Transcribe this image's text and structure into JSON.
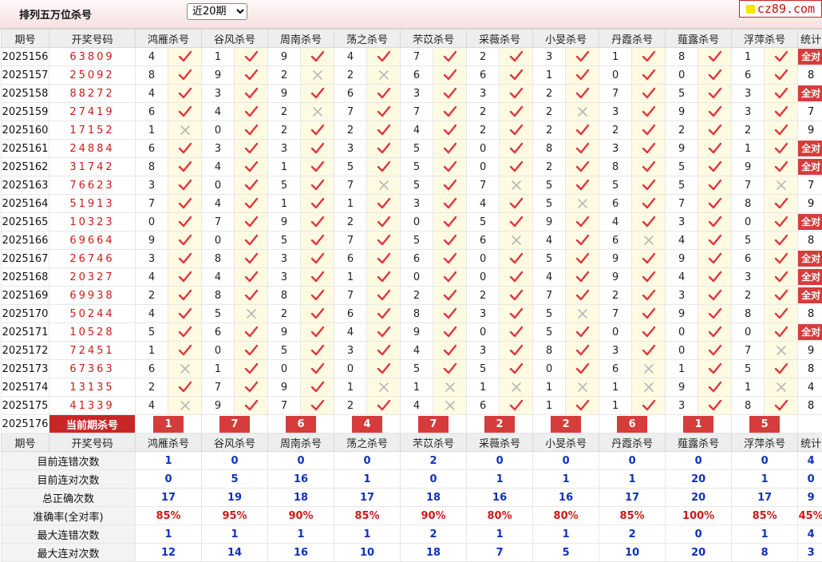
{
  "header": {
    "title": "排列五万位杀号",
    "period_select": "近20期",
    "logo_text": "cz89.com"
  },
  "columns": [
    "期号",
    "开奖号码",
    "鸿雁杀号",
    "谷风杀号",
    "周南杀号",
    "荡之杀号",
    "芣苡杀号",
    "采薇杀号",
    "小旻杀号",
    "丹霞杀号",
    "薤露杀号",
    "浮萍杀号",
    "统计"
  ],
  "all_right_label": "全对",
  "rows": [
    {
      "issue": "2025156",
      "nums": "63809",
      "kills": [
        [
          4,
          1
        ],
        [
          1,
          1
        ],
        [
          9,
          1
        ],
        [
          4,
          1
        ],
        [
          7,
          1
        ],
        [
          2,
          1
        ],
        [
          3,
          1
        ],
        [
          1,
          1
        ],
        [
          8,
          1
        ],
        [
          1,
          1
        ]
      ],
      "stat": "全对"
    },
    {
      "issue": "2025157",
      "nums": "25092",
      "kills": [
        [
          8,
          1
        ],
        [
          9,
          1
        ],
        [
          2,
          0
        ],
        [
          2,
          0
        ],
        [
          6,
          1
        ],
        [
          6,
          1
        ],
        [
          1,
          1
        ],
        [
          0,
          1
        ],
        [
          0,
          1
        ],
        [
          6,
          1
        ]
      ],
      "stat": "8"
    },
    {
      "issue": "2025158",
      "nums": "88272",
      "kills": [
        [
          4,
          1
        ],
        [
          3,
          1
        ],
        [
          9,
          1
        ],
        [
          6,
          1
        ],
        [
          3,
          1
        ],
        [
          3,
          1
        ],
        [
          2,
          1
        ],
        [
          7,
          1
        ],
        [
          5,
          1
        ],
        [
          3,
          1
        ]
      ],
      "stat": "全对"
    },
    {
      "issue": "2025159",
      "nums": "27419",
      "kills": [
        [
          6,
          1
        ],
        [
          4,
          1
        ],
        [
          2,
          0
        ],
        [
          7,
          1
        ],
        [
          7,
          1
        ],
        [
          2,
          1
        ],
        [
          2,
          0
        ],
        [
          3,
          1
        ],
        [
          9,
          1
        ],
        [
          3,
          1
        ]
      ],
      "stat": "7"
    },
    {
      "issue": "2025160",
      "nums": "17152",
      "kills": [
        [
          1,
          0
        ],
        [
          0,
          1
        ],
        [
          2,
          1
        ],
        [
          2,
          1
        ],
        [
          4,
          1
        ],
        [
          2,
          1
        ],
        [
          2,
          1
        ],
        [
          2,
          1
        ],
        [
          2,
          1
        ],
        [
          2,
          1
        ]
      ],
      "stat": "9"
    },
    {
      "issue": "2025161",
      "nums": "24884",
      "kills": [
        [
          6,
          1
        ],
        [
          3,
          1
        ],
        [
          3,
          1
        ],
        [
          3,
          1
        ],
        [
          5,
          1
        ],
        [
          0,
          1
        ],
        [
          8,
          1
        ],
        [
          3,
          1
        ],
        [
          9,
          1
        ],
        [
          1,
          1
        ]
      ],
      "stat": "全对"
    },
    {
      "issue": "2025162",
      "nums": "31742",
      "kills": [
        [
          8,
          1
        ],
        [
          4,
          1
        ],
        [
          1,
          1
        ],
        [
          5,
          1
        ],
        [
          5,
          1
        ],
        [
          0,
          1
        ],
        [
          2,
          1
        ],
        [
          8,
          1
        ],
        [
          5,
          1
        ],
        [
          9,
          1
        ]
      ],
      "stat": "全对"
    },
    {
      "issue": "2025163",
      "nums": "76623",
      "kills": [
        [
          3,
          1
        ],
        [
          0,
          1
        ],
        [
          5,
          1
        ],
        [
          7,
          0
        ],
        [
          5,
          1
        ],
        [
          7,
          0
        ],
        [
          5,
          1
        ],
        [
          5,
          1
        ],
        [
          5,
          1
        ],
        [
          7,
          0
        ]
      ],
      "stat": "7"
    },
    {
      "issue": "2025164",
      "nums": "51913",
      "kills": [
        [
          7,
          1
        ],
        [
          4,
          1
        ],
        [
          1,
          1
        ],
        [
          1,
          1
        ],
        [
          3,
          1
        ],
        [
          4,
          1
        ],
        [
          5,
          0
        ],
        [
          6,
          1
        ],
        [
          7,
          1
        ],
        [
          8,
          1
        ]
      ],
      "stat": "9"
    },
    {
      "issue": "2025165",
      "nums": "10323",
      "kills": [
        [
          0,
          1
        ],
        [
          7,
          1
        ],
        [
          9,
          1
        ],
        [
          2,
          1
        ],
        [
          0,
          1
        ],
        [
          5,
          1
        ],
        [
          9,
          1
        ],
        [
          4,
          1
        ],
        [
          3,
          1
        ],
        [
          0,
          1
        ]
      ],
      "stat": "全对"
    },
    {
      "issue": "2025166",
      "nums": "69664",
      "kills": [
        [
          9,
          1
        ],
        [
          0,
          1
        ],
        [
          5,
          1
        ],
        [
          7,
          1
        ],
        [
          5,
          1
        ],
        [
          6,
          0
        ],
        [
          4,
          1
        ],
        [
          6,
          0
        ],
        [
          4,
          1
        ],
        [
          5,
          1
        ]
      ],
      "stat": "8"
    },
    {
      "issue": "2025167",
      "nums": "26746",
      "kills": [
        [
          3,
          1
        ],
        [
          8,
          1
        ],
        [
          3,
          1
        ],
        [
          6,
          1
        ],
        [
          6,
          1
        ],
        [
          0,
          1
        ],
        [
          5,
          1
        ],
        [
          9,
          1
        ],
        [
          9,
          1
        ],
        [
          6,
          1
        ]
      ],
      "stat": "全对"
    },
    {
      "issue": "2025168",
      "nums": "20327",
      "kills": [
        [
          4,
          1
        ],
        [
          4,
          1
        ],
        [
          3,
          1
        ],
        [
          1,
          1
        ],
        [
          0,
          1
        ],
        [
          0,
          1
        ],
        [
          4,
          1
        ],
        [
          9,
          1
        ],
        [
          4,
          1
        ],
        [
          3,
          1
        ]
      ],
      "stat": "全对"
    },
    {
      "issue": "2025169",
      "nums": "69938",
      "kills": [
        [
          2,
          1
        ],
        [
          8,
          1
        ],
        [
          8,
          1
        ],
        [
          7,
          1
        ],
        [
          2,
          1
        ],
        [
          2,
          1
        ],
        [
          7,
          1
        ],
        [
          2,
          1
        ],
        [
          3,
          1
        ],
        [
          2,
          1
        ]
      ],
      "stat": "全对"
    },
    {
      "issue": "2025170",
      "nums": "50244",
      "kills": [
        [
          4,
          1
        ],
        [
          5,
          0
        ],
        [
          2,
          1
        ],
        [
          6,
          1
        ],
        [
          8,
          1
        ],
        [
          3,
          1
        ],
        [
          5,
          0
        ],
        [
          7,
          1
        ],
        [
          9,
          1
        ],
        [
          8,
          1
        ]
      ],
      "stat": "8"
    },
    {
      "issue": "2025171",
      "nums": "10528",
      "kills": [
        [
          5,
          1
        ],
        [
          6,
          1
        ],
        [
          9,
          1
        ],
        [
          4,
          1
        ],
        [
          9,
          1
        ],
        [
          0,
          1
        ],
        [
          5,
          1
        ],
        [
          0,
          1
        ],
        [
          0,
          1
        ],
        [
          0,
          1
        ]
      ],
      "stat": "全对"
    },
    {
      "issue": "2025172",
      "nums": "72451",
      "kills": [
        [
          1,
          1
        ],
        [
          0,
          1
        ],
        [
          5,
          1
        ],
        [
          3,
          1
        ],
        [
          4,
          1
        ],
        [
          3,
          1
        ],
        [
          8,
          1
        ],
        [
          3,
          1
        ],
        [
          0,
          1
        ],
        [
          7,
          0
        ]
      ],
      "stat": "9"
    },
    {
      "issue": "2025173",
      "nums": "67363",
      "kills": [
        [
          6,
          0
        ],
        [
          1,
          1
        ],
        [
          0,
          1
        ],
        [
          0,
          1
        ],
        [
          5,
          1
        ],
        [
          5,
          1
        ],
        [
          0,
          1
        ],
        [
          6,
          0
        ],
        [
          1,
          1
        ],
        [
          5,
          1
        ]
      ],
      "stat": "8"
    },
    {
      "issue": "2025174",
      "nums": "13135",
      "kills": [
        [
          2,
          1
        ],
        [
          7,
          1
        ],
        [
          9,
          1
        ],
        [
          1,
          0
        ],
        [
          1,
          0
        ],
        [
          1,
          0
        ],
        [
          1,
          0
        ],
        [
          1,
          0
        ],
        [
          9,
          1
        ],
        [
          1,
          0
        ]
      ],
      "stat": "4"
    },
    {
      "issue": "2025175",
      "nums": "41339",
      "kills": [
        [
          4,
          0
        ],
        [
          9,
          1
        ],
        [
          7,
          1
        ],
        [
          2,
          1
        ],
        [
          4,
          0
        ],
        [
          6,
          1
        ],
        [
          1,
          1
        ],
        [
          1,
          1
        ],
        [
          3,
          1
        ],
        [
          8,
          1
        ]
      ],
      "stat": "8"
    }
  ],
  "current": {
    "issue": "2025176",
    "label": "当前期杀号",
    "kills": [
      "1",
      "7",
      "6",
      "4",
      "7",
      "2",
      "2",
      "6",
      "1",
      "5"
    ]
  },
  "summary": [
    {
      "label": "目前连错次数",
      "values": [
        "1",
        "0",
        "0",
        "0",
        "2",
        "0",
        "0",
        "0",
        "0",
        "0"
      ],
      "stat": "4"
    },
    {
      "label": "目前连对次数",
      "values": [
        "0",
        "5",
        "16",
        "1",
        "0",
        "1",
        "1",
        "1",
        "20",
        "1"
      ],
      "stat": "0"
    },
    {
      "label": "总正确次数",
      "values": [
        "17",
        "19",
        "18",
        "17",
        "18",
        "16",
        "16",
        "17",
        "20",
        "17"
      ],
      "stat": "9"
    },
    {
      "label": "准确率(全对率)",
      "values": [
        "85%",
        "95%",
        "90%",
        "85%",
        "90%",
        "80%",
        "80%",
        "85%",
        "100%",
        "85%"
      ],
      "stat": "45%"
    },
    {
      "label": "最大连错次数",
      "values": [
        "1",
        "1",
        "1",
        "1",
        "2",
        "1",
        "1",
        "2",
        "0",
        "1"
      ],
      "stat": "4"
    },
    {
      "label": "最大连对次数",
      "values": [
        "12",
        "14",
        "16",
        "10",
        "18",
        "7",
        "5",
        "10",
        "20",
        "8"
      ],
      "stat": "3"
    }
  ],
  "colors": {
    "red": "#d01818",
    "check": "#e0353d",
    "cross": "#b8b8b8",
    "blue": "#1030c0",
    "mark_bg": "#fffbe3"
  }
}
